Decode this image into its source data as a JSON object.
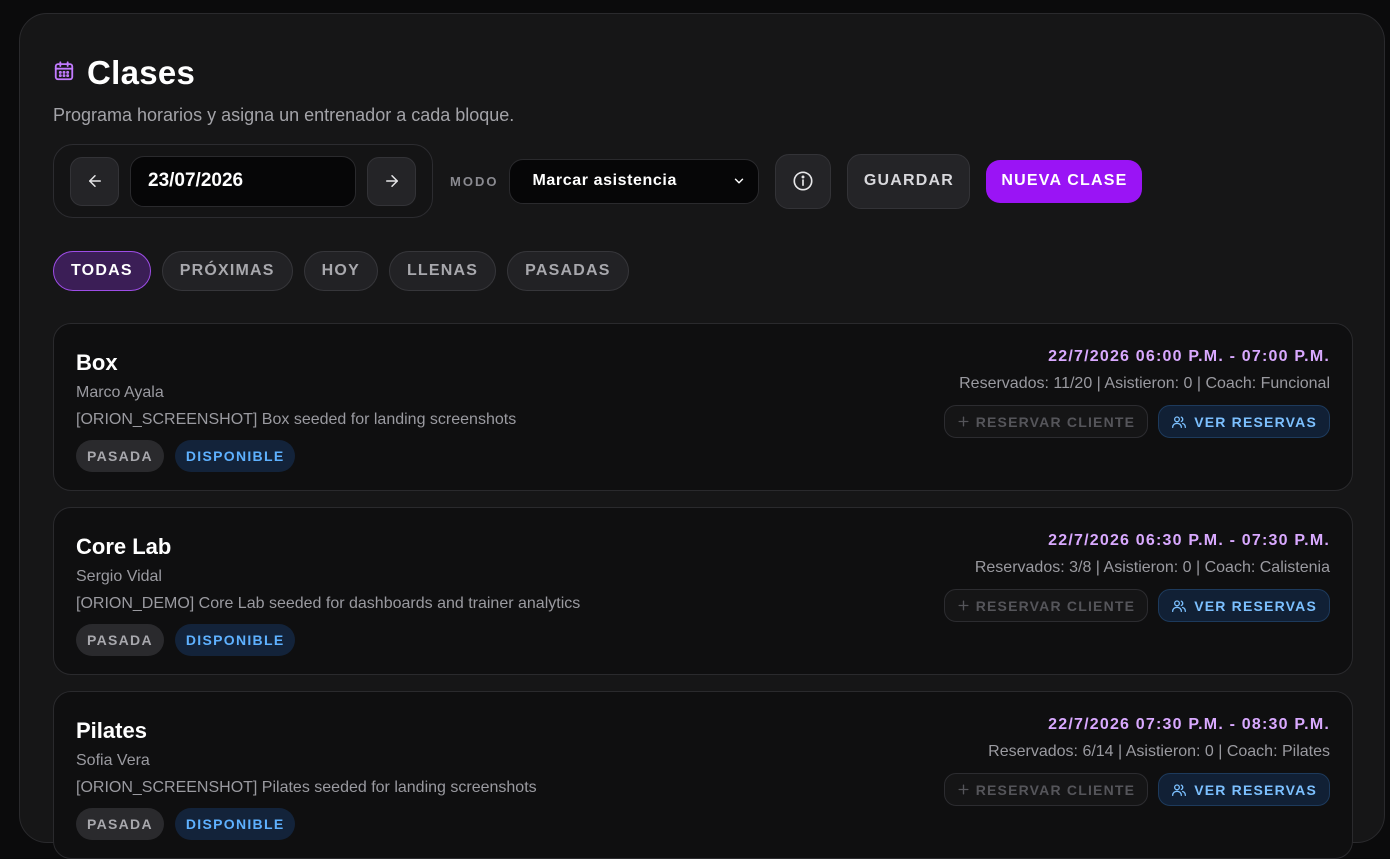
{
  "header": {
    "title": "Clases",
    "subtitle": "Programa horarios y asigna un entrenador a cada bloque.",
    "icon": "calendar-icon"
  },
  "toolbar": {
    "date_value": "23/07/2026",
    "mode_label": "MODO",
    "mode_value": "Marcar asistencia",
    "save_label": "GUARDAR",
    "new_label": "NUEVA CLASE"
  },
  "filters": [
    {
      "label": "TODAS",
      "active": true
    },
    {
      "label": "PRÓXIMAS",
      "active": false
    },
    {
      "label": "HOY",
      "active": false
    },
    {
      "label": "LLENAS",
      "active": false
    },
    {
      "label": "PASADAS",
      "active": false
    }
  ],
  "classes": [
    {
      "name": "Box",
      "trainer": "Marco Ayala",
      "description": "[ORION_SCREENSHOT] Box seeded for landing screenshots",
      "badges": [
        "PASADA",
        "DISPONIBLE"
      ],
      "time": "22/7/2026 06:00 P.M. - 07:00 P.M.",
      "stats": "Reservados: 11/20 | Asistieron: 0 | Coach: Funcional",
      "reserve_label": "RESERVAR CLIENTE",
      "view_label": "VER RESERVAS"
    },
    {
      "name": "Core Lab",
      "trainer": "Sergio Vidal",
      "description": "[ORION_DEMO] Core Lab seeded for dashboards and trainer analytics",
      "badges": [
        "PASADA",
        "DISPONIBLE"
      ],
      "time": "22/7/2026 06:30 P.M. - 07:30 P.M.",
      "stats": "Reservados: 3/8 | Asistieron: 0 | Coach: Calistenia",
      "reserve_label": "RESERVAR CLIENTE",
      "view_label": "VER RESERVAS"
    },
    {
      "name": "Pilates",
      "trainer": "Sofia Vera",
      "description": "[ORION_SCREENSHOT] Pilates seeded for landing screenshots",
      "badges": [
        "PASADA",
        "DISPONIBLE"
      ],
      "time": "22/7/2026 07:30 P.M. - 08:30 P.M.",
      "stats": "Reservados: 6/14 | Asistieron: 0 | Coach: Pilates",
      "reserve_label": "RESERVAR CLIENTE",
      "view_label": "VER RESERVAS"
    }
  ],
  "colors": {
    "accent": "#9a14f5",
    "time": "#d9a9ff",
    "available": "#5eb1ff"
  }
}
